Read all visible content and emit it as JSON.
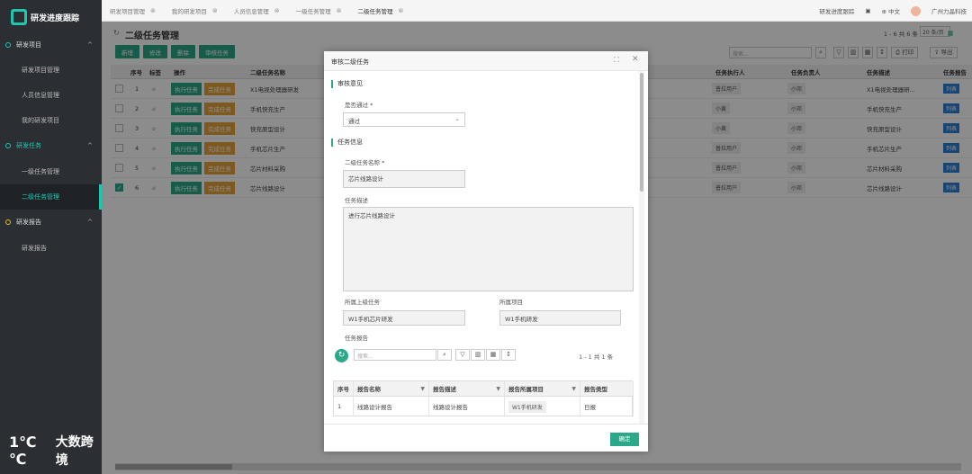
{
  "app": {
    "title": "研发进度跟踪"
  },
  "sidebar": {
    "groups": [
      {
        "label": "研发项目",
        "items": [
          "研发项目管理",
          "人员信息管理",
          "我的研发项目"
        ]
      },
      {
        "label": "研发任务",
        "items": [
          "一级任务管理",
          "二级任务管理"
        ]
      },
      {
        "label": "研发报告",
        "items": [
          "研发报告"
        ]
      }
    ]
  },
  "topbar": {
    "tabs": [
      "研发项目管理",
      "我的研发项目",
      "人员信息管理",
      "一级任务管理",
      "二级任务管理"
    ],
    "active_tab": "二级任务管理",
    "right": {
      "link": "研发进度跟踪",
      "lang": "中文",
      "company": "广州力晶科技"
    }
  },
  "page": {
    "title": "二级任务管理",
    "buttons": [
      "新增",
      "修改",
      "删除",
      "审核任务"
    ],
    "pager": "1 - 6 共 6 条",
    "page_size": "20 条/页",
    "search_placeholder": "搜索...",
    "print": "打印",
    "export": "导出"
  },
  "table": {
    "headers": [
      "序号",
      "标签",
      "操作",
      "二级任务名称",
      "任务执行人",
      "任务负责人",
      "任务描述",
      "任务报告"
    ],
    "action_labels": [
      "执行任务",
      "完成任务"
    ],
    "report_label": "列表",
    "rows": [
      {
        "no": "1",
        "name": "X1电视处理器研发",
        "executor": "普拉用户",
        "owner": "小邓",
        "desc": "X1电视处理器研...",
        "checked": false
      },
      {
        "no": "2",
        "name": "手机快充生产",
        "executor": "小黄",
        "owner": "小邓",
        "desc": "手机快充生产",
        "checked": false
      },
      {
        "no": "3",
        "name": "快充原型设计",
        "executor": "小黄",
        "owner": "小邓",
        "desc": "快充原型设计",
        "checked": false
      },
      {
        "no": "4",
        "name": "手机芯片生产",
        "executor": "普拉用户",
        "owner": "小邓",
        "desc": "手机芯片生产",
        "checked": false
      },
      {
        "no": "5",
        "name": "芯片材料采购",
        "executor": "普拉用户",
        "owner": "小邓",
        "desc": "芯片材料采购",
        "checked": false
      },
      {
        "no": "6",
        "name": "芯片线路设计",
        "executor": "普拉用户",
        "owner": "小邓",
        "desc": "芯片线路设计",
        "checked": true
      }
    ]
  },
  "modal": {
    "title": "审核二级任务",
    "section_review": "审核意见",
    "pass_label": "是否通过 *",
    "pass_value": "通过",
    "section_task": "任务信息",
    "name_label": "二级任务名称 *",
    "name_value": "芯片线路设计",
    "desc_label": "任务描述",
    "desc_value": "进行芯片线路设计",
    "parent_label": "所属上级任务",
    "parent_value": "W1手机芯片研发",
    "project_label": "所属项目",
    "project_value": "W1手机研发",
    "report_label": "任务报告",
    "sub_search_placeholder": "搜索...",
    "sub_pager": "1 - 1 共 1 条",
    "sub_headers": [
      "序号",
      "报告名称",
      "报告描述",
      "报告所属项目",
      "报告类型"
    ],
    "sub_row": {
      "no": "1",
      "name": "线路设计报告",
      "desc": "线路设计报告",
      "project": "W1手机研发",
      "type": "日报"
    },
    "ok": "确定"
  },
  "watermark": {
    "logo": "1℃℃",
    "text": "大数跨境"
  }
}
